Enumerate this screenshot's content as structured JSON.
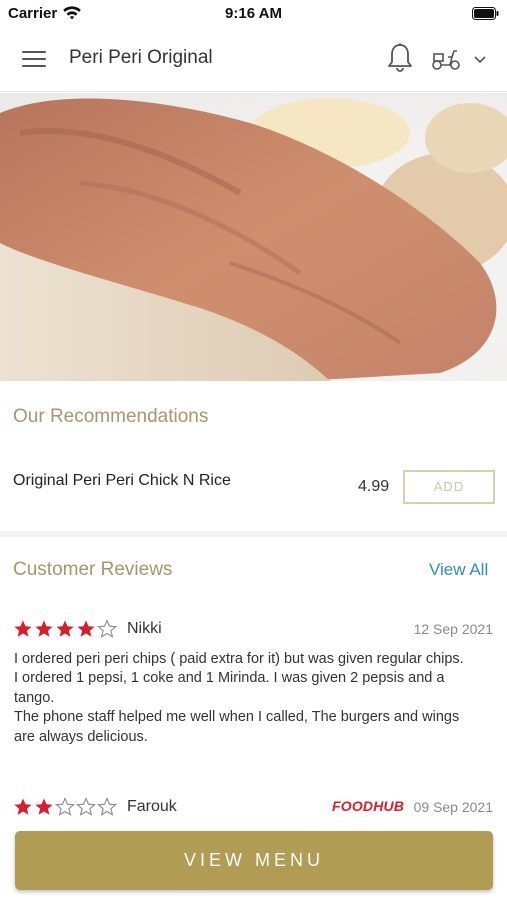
{
  "status_bar": {
    "carrier": "Carrier",
    "time": "9:16 AM"
  },
  "header": {
    "title": "Peri Peri Original"
  },
  "recommendations": {
    "title": "Our Recommendations",
    "items": [
      {
        "name": "Original Peri Peri Chick N Rice",
        "price": "4.99",
        "add_label": "ADD"
      }
    ]
  },
  "reviews": {
    "title": "Customer Reviews",
    "view_all_label": "View All",
    "items": [
      {
        "rating": 4,
        "name": "Nikki",
        "date": "12 Sep 2021",
        "lines": [
          "I ordered peri peri chips ( paid extra for it) but was given regular chips.",
          "I ordered 1 pepsi, 1 coke and 1 Mirinda. I was given 2 pepsis and a tango.",
          "The phone staff helped me well when I called, The burgers and wings are always delicious."
        ]
      },
      {
        "rating": 2,
        "name": "Farouk",
        "date": "09 Sep 2021",
        "source_logo": "FOODHUB"
      }
    ]
  },
  "footer": {
    "view_menu_label": "VIEW MENU"
  },
  "colors": {
    "accent_gold": "#b09c52",
    "section_title": "#a69669",
    "link_blue": "#2e8fb5",
    "star_red": "#d81e2a"
  }
}
